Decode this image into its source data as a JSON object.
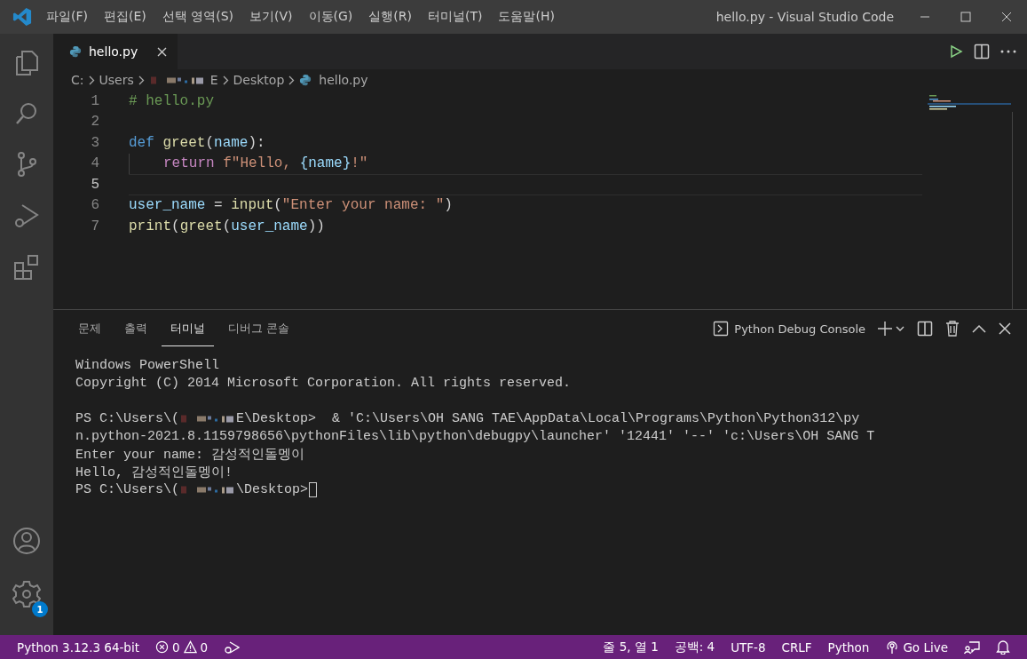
{
  "window": {
    "title": "hello.py - Visual Studio Code"
  },
  "menu": [
    "파일(F)",
    "편집(E)",
    "선택 영역(S)",
    "보기(V)",
    "이동(G)",
    "실행(R)",
    "터미널(T)",
    "도움말(H)"
  ],
  "activity_bar": {
    "settings_badge": "1"
  },
  "tabs": [
    {
      "label": "hello.py",
      "selected": true
    }
  ],
  "breadcrumb": [
    {
      "kind": "text",
      "label": "C:"
    },
    {
      "kind": "text",
      "label": "Users"
    },
    {
      "kind": "redacted",
      "label": "E"
    },
    {
      "kind": "text",
      "label": "Desktop"
    },
    {
      "kind": "file",
      "label": "hello.py"
    }
  ],
  "code": [
    {
      "number": "1",
      "current": false,
      "tokens": [
        {
          "kind": "comment",
          "t": "# hello.py"
        }
      ]
    },
    {
      "number": "2",
      "current": false
    },
    {
      "number": "3",
      "current": false,
      "tokens": [
        {
          "kind": "keyword",
          "t": "def"
        },
        {
          "kind": "function",
          "t": " greet"
        },
        {
          "kind": "plain",
          "t": "("
        },
        {
          "kind": "variable",
          "t": "name"
        },
        {
          "kind": "plain",
          "t": "):"
        }
      ]
    },
    {
      "number": "4",
      "current": false,
      "indent": true,
      "tokens": [
        {
          "kind": "control",
          "t": "return"
        },
        {
          "kind": "string",
          "t": " f\"Hello, "
        },
        {
          "kind": "variable",
          "t": "{name}"
        },
        {
          "kind": "string",
          "t": "!\""
        }
      ]
    },
    {
      "number": "5",
      "current": true
    },
    {
      "number": "6",
      "current": false,
      "tokens": [
        {
          "kind": "variable",
          "t": "user_name"
        },
        {
          "kind": "plain",
          "t": " = "
        },
        {
          "kind": "function",
          "t": "input"
        },
        {
          "kind": "plain",
          "t": "("
        },
        {
          "kind": "string",
          "t": "\"Enter your name: \""
        },
        {
          "kind": "plain",
          "t": ")"
        }
      ]
    },
    {
      "number": "7",
      "current": false,
      "tokens": [
        {
          "kind": "function",
          "t": "print"
        },
        {
          "kind": "plain",
          "t": "("
        },
        {
          "kind": "function",
          "t": "greet"
        },
        {
          "kind": "plain",
          "t": "("
        },
        {
          "kind": "variable",
          "t": "user_name"
        },
        {
          "kind": "plain",
          "t": "))"
        }
      ]
    }
  ],
  "panel": {
    "tabs": [
      {
        "label": "문제",
        "selected": false
      },
      {
        "label": "출력",
        "selected": false
      },
      {
        "label": "터미널",
        "selected": true
      },
      {
        "label": "디버그 콘솔",
        "selected": false
      }
    ],
    "terminal_select": "Python Debug Console",
    "terminal": [
      {
        "cursor": false,
        "parts": [
          {
            "kind": "text",
            "t": "Windows PowerShell"
          }
        ]
      },
      {
        "cursor": false,
        "parts": [
          {
            "kind": "text",
            "t": "Copyright (C) 2014 Microsoft Corporation. All rights reserved."
          }
        ]
      },
      {
        "cursor": false
      },
      {
        "cursor": false,
        "parts": [
          {
            "kind": "text",
            "t": "PS C:\\Users\\("
          },
          {
            "kind": "redacted"
          },
          {
            "kind": "text",
            "t": "E\\Desktop>  & 'C:\\Users\\OH SANG TAE\\AppData\\Local\\Programs\\Python\\Python312\\py"
          }
        ]
      },
      {
        "cursor": false,
        "parts": [
          {
            "kind": "text",
            "t": "n.python-2021.8.1159798656\\pythonFiles\\lib\\python\\debugpy\\launcher' '12441' '--' 'c:\\Users\\OH SANG T"
          }
        ]
      },
      {
        "cursor": false,
        "parts": [
          {
            "kind": "text",
            "t": "Enter your name: 감성적인돌멩이"
          }
        ]
      },
      {
        "cursor": false,
        "parts": [
          {
            "kind": "text",
            "t": "Hello, 감성적인돌멩이!"
          }
        ]
      },
      {
        "cursor": true,
        "parts": [
          {
            "kind": "text",
            "t": "PS C:\\Users\\("
          },
          {
            "kind": "redacted"
          },
          {
            "kind": "text",
            "t": "\\Desktop>"
          }
        ]
      }
    ]
  },
  "status_bar": {
    "interpreter": "Python 3.12.3 64-bit",
    "errors": "0",
    "warnings": "0",
    "position": "줄 5, 열 1",
    "indent": "공백: 4",
    "encoding": "UTF-8",
    "eol": "CRLF",
    "language": "Python",
    "live": "Go Live"
  }
}
